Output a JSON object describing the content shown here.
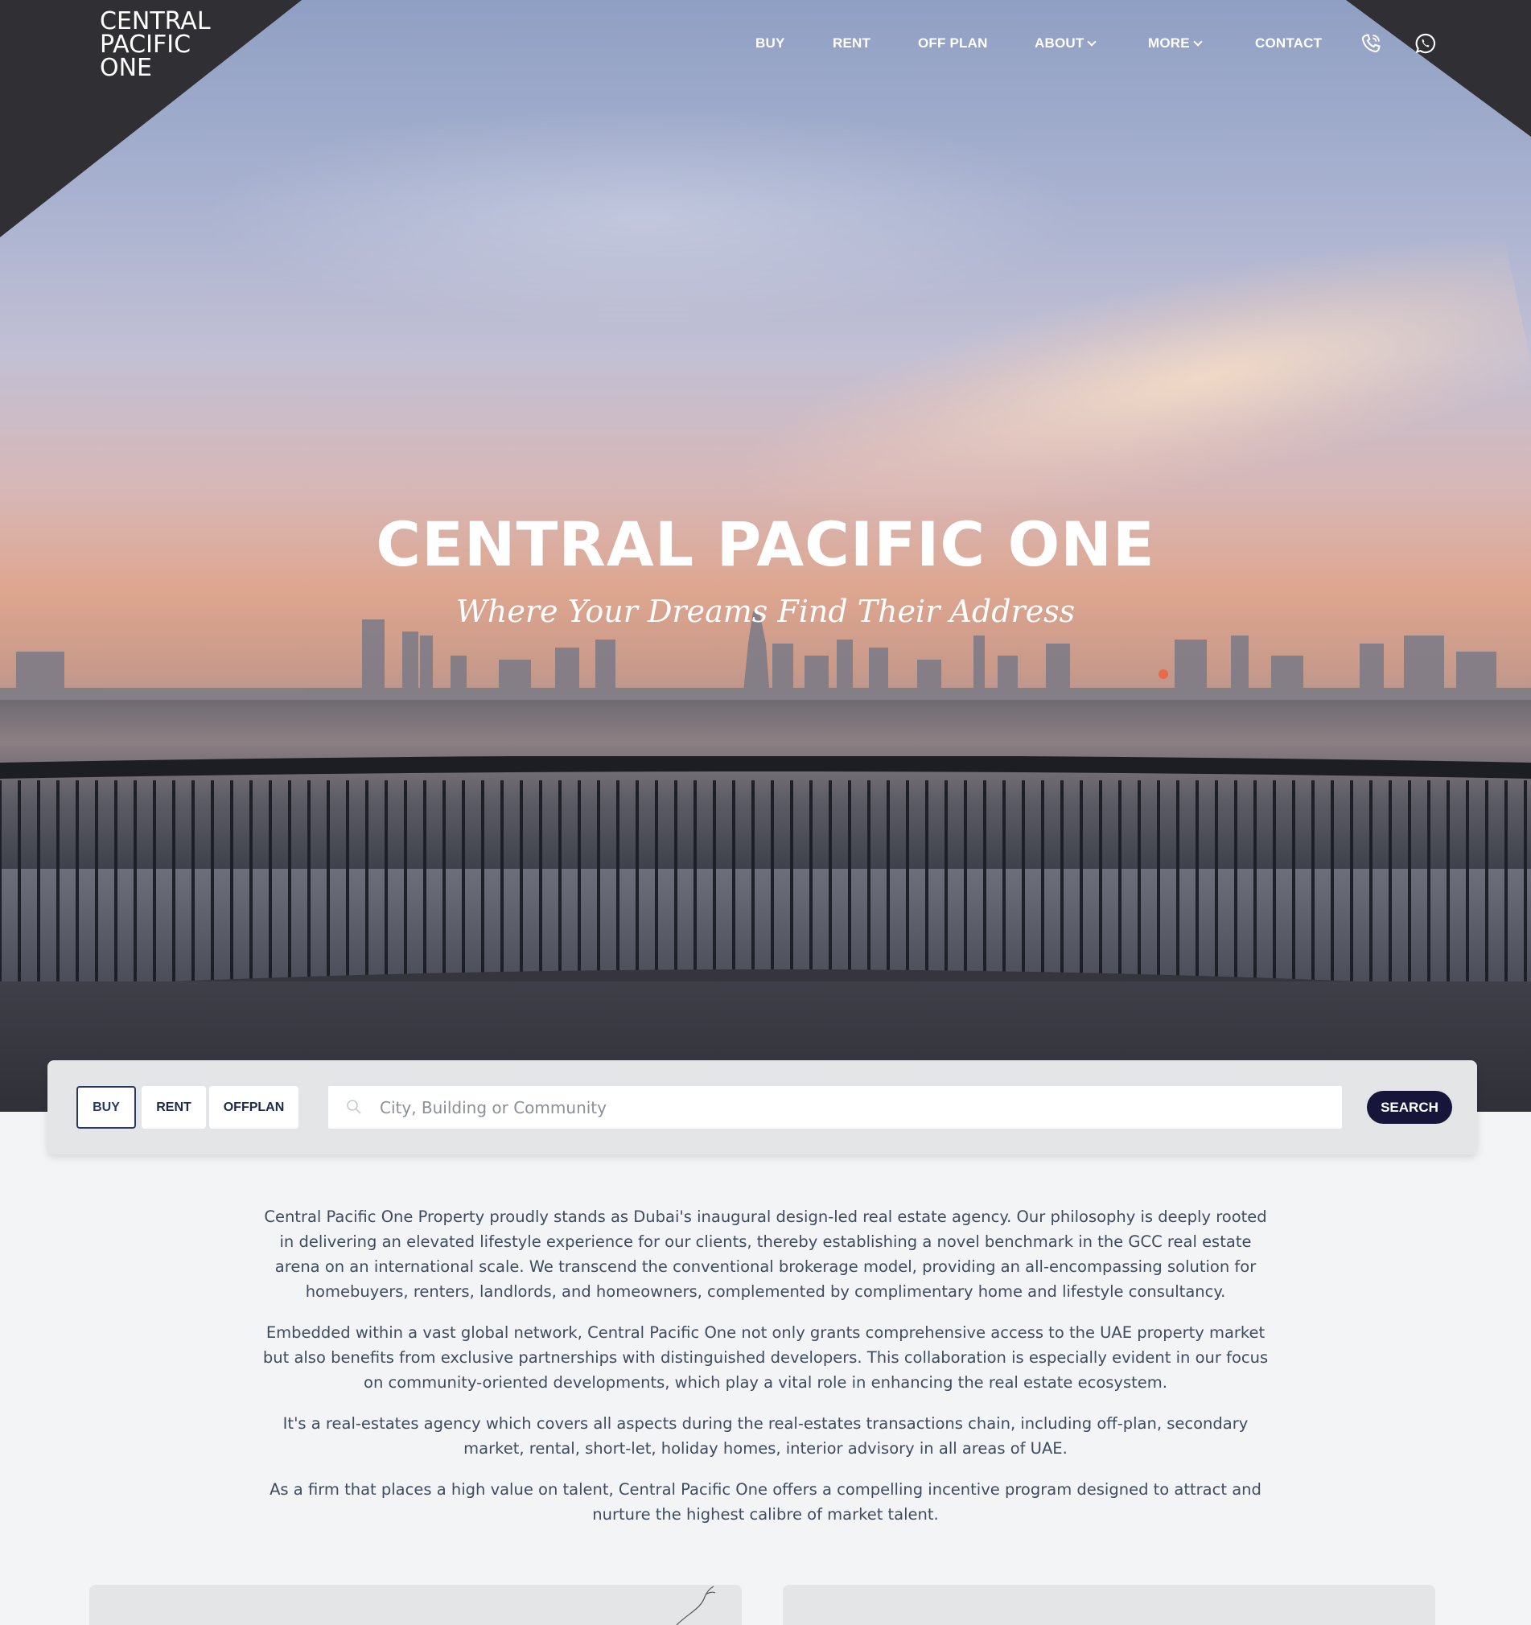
{
  "header": {
    "logo_line1": "CENTRAL",
    "logo_line2": "PACIFIC",
    "logo_line3": "ONE",
    "nav": [
      {
        "label": "BUY"
      },
      {
        "label": "RENT"
      },
      {
        "label": "OFF PLAN"
      },
      {
        "label": "ABOUT",
        "has_dropdown": true
      },
      {
        "label": "MORE",
        "has_dropdown": true
      },
      {
        "label": "CONTACT"
      }
    ],
    "icons": [
      "phone-icon",
      "whatsapp-icon"
    ]
  },
  "hero": {
    "title": "CENTRAL PACIFIC ONE",
    "tagline": "Where Your Dreams Find Their Address"
  },
  "search": {
    "tabs": [
      "BUY",
      "RENT",
      "OFFPLAN"
    ],
    "active_tab": "BUY",
    "placeholder": "City, Building or Community",
    "button_label": "SEARCH"
  },
  "intro": {
    "paragraphs": [
      "Central Pacific One Property proudly stands as Dubai's inaugural design-led real estate agency. Our philosophy is deeply rooted in delivering an elevated lifestyle experience for our clients, thereby establishing a novel benchmark in the GCC real estate arena on an international scale. We transcend the conventional brokerage model, providing an all-encompassing solution for homebuyers, renters, landlords, and homeowners, complemented by complimentary home and lifestyle consultancy.",
      "Embedded within a vast global network, Central Pacific One not only grants comprehensive access to the UAE property market but also benefits from exclusive partnerships with distinguished developers. This collaboration is especially evident in our focus on community-oriented developments, which play a vital role in enhancing the real estate ecosystem.",
      "It's a real-estates agency which covers all aspects during the real-estates transactions chain, including off-plan, secondary market, rental, short-let, holiday homes, interior advisory in all areas of UAE.",
      "As a firm that places a high value on talent, Central Pacific One offers a compelling incentive program designed to attract and nurture the highest calibre of market talent."
    ]
  },
  "colors": {
    "nav_dark": "#2f2f34",
    "search_button": "#15163a",
    "active_tab_border": "#253866",
    "page_bg": "#f3f4f6"
  }
}
